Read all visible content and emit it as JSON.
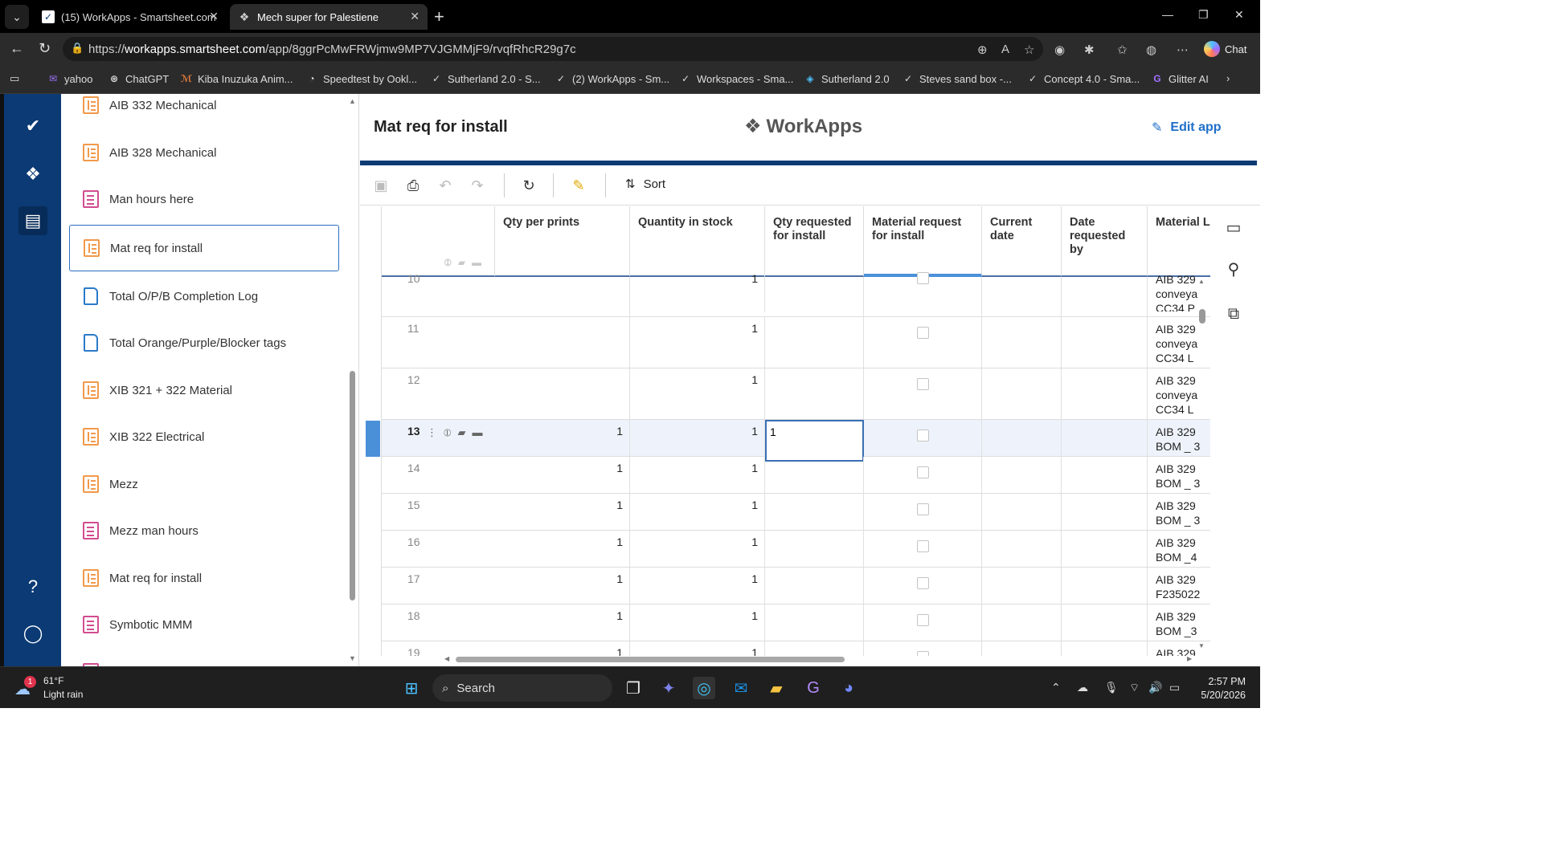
{
  "browser": {
    "tabs": [
      {
        "title": "(15) WorkApps - Smartsheet.com"
      },
      {
        "title": "Mech super for Palestiene"
      }
    ],
    "url_prefix": "https://",
    "url_host": "workapps.smartsheet.com",
    "url_path": "/app/8ggrPcMwFRWjmw9MP7VJGMMjF9/rvqfRhcR29g7c",
    "chat_label": "Chat",
    "bookmarks": [
      {
        "label": "yahoo"
      },
      {
        "label": "ChatGPT"
      },
      {
        "label": "Kiba Inuzuka Anim..."
      },
      {
        "label": "Speedtest by Ookl..."
      },
      {
        "label": "Sutherland 2.0 - S..."
      },
      {
        "label": "(2) WorkApps - Sm..."
      },
      {
        "label": "Workspaces - Sma..."
      },
      {
        "label": "Sutherland 2.0"
      },
      {
        "label": "Steves sand box -..."
      },
      {
        "label": "Concept 4.0 - Sma..."
      },
      {
        "label": "Glitter AI"
      }
    ]
  },
  "sidebar": {
    "items": [
      {
        "label": "AIB 332 Mechanical",
        "icon": "sheet-icon"
      },
      {
        "label": "AIB 328 Mechanical",
        "icon": "sheet-icon"
      },
      {
        "label": "Man hours here",
        "icon": "form-icon"
      },
      {
        "label": "Mat req for install",
        "icon": "sheet-icon"
      },
      {
        "label": "Total O/P/B Completion Log",
        "icon": "report-icon"
      },
      {
        "label": "Total Orange/Purple/Blocker tags",
        "icon": "report-icon"
      },
      {
        "label": "XIB 321 + 322 Material",
        "icon": "sheet-icon"
      },
      {
        "label": "XIB 322 Electrical",
        "icon": "sheet-icon"
      },
      {
        "label": "Mezz",
        "icon": "sheet-icon"
      },
      {
        "label": "Mezz man hours",
        "icon": "form-icon"
      },
      {
        "label": "Mat req for install",
        "icon": "sheet-icon"
      },
      {
        "label": "Symbotic MMM",
        "icon": "form-icon"
      }
    ]
  },
  "app": {
    "title": "Mat req for install",
    "brand": "WorkApps",
    "edit_label": "Edit app",
    "sort_label": "Sort"
  },
  "grid": {
    "columns": [
      {
        "label": "Qty per prints"
      },
      {
        "label": "Quantity in stock"
      },
      {
        "label": "Qty requested for install"
      },
      {
        "label": "Material request for install"
      },
      {
        "label": "Current date"
      },
      {
        "label": "Date requested by"
      },
      {
        "label": "Material L"
      }
    ],
    "rows": [
      {
        "num": "10",
        "qty_prints": "",
        "qty_stock": "1",
        "qty_req": "",
        "material": [
          "AIB 329",
          "conveya",
          "CC34 P"
        ]
      },
      {
        "num": "11",
        "qty_prints": "",
        "qty_stock": "1",
        "qty_req": "",
        "material": [
          "AIB 329",
          "conveya",
          "CC34 L"
        ]
      },
      {
        "num": "12",
        "qty_prints": "",
        "qty_stock": "1",
        "qty_req": "",
        "material": [
          "AIB 329",
          "conveya",
          "CC34 L"
        ]
      },
      {
        "num": "13",
        "qty_prints": "1",
        "qty_stock": "1",
        "qty_req": "1",
        "material": [
          "AIB 329",
          "BOM _ 3"
        ]
      },
      {
        "num": "14",
        "qty_prints": "1",
        "qty_stock": "1",
        "qty_req": "",
        "material": [
          "AIB 329",
          "BOM _ 3"
        ]
      },
      {
        "num": "15",
        "qty_prints": "1",
        "qty_stock": "1",
        "qty_req": "",
        "material": [
          "AIB 329",
          "BOM _ 3"
        ]
      },
      {
        "num": "16",
        "qty_prints": "1",
        "qty_stock": "1",
        "qty_req": "",
        "material": [
          "AIB 329",
          "BOM _4"
        ]
      },
      {
        "num": "17",
        "qty_prints": "1",
        "qty_stock": "1",
        "qty_req": "",
        "material": [
          "AIB 329",
          "F235022"
        ]
      },
      {
        "num": "18",
        "qty_prints": "1",
        "qty_stock": "1",
        "qty_req": "",
        "material": [
          "AIB 329",
          "BOM _3"
        ]
      },
      {
        "num": "19",
        "qty_prints": "1",
        "qty_stock": "1",
        "qty_req": "",
        "material": [
          "AIB 329"
        ]
      }
    ]
  },
  "taskbar": {
    "temp": "61°F",
    "weather": "Light rain",
    "weather_badge": "1",
    "search_label": "Search",
    "time": "2:57 PM",
    "date": "5/20/2026"
  }
}
